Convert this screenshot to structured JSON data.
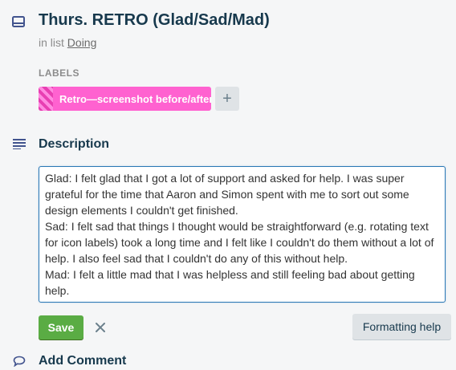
{
  "card": {
    "title": "Thurs. RETRO (Glad/Sad/Mad)",
    "in_list_prefix": "in list ",
    "list_name": "Doing"
  },
  "labels": {
    "heading": "LABELS",
    "items": [
      {
        "text": "Retro—screenshot before/after",
        "color": "#ff62d0"
      }
    ],
    "add_symbol": "+"
  },
  "description": {
    "heading": "Description",
    "value": "Glad: I felt glad that I got a lot of support and asked for help. I was super grateful for the time that Aaron and Simon spent with me to sort out some design elements I couldn't get finished.\nSad: I felt sad that things I thought would be straightforward (e.g. rotating text for icon labels) took a long time and I felt like I couldn't do them without a lot of help. I also feel sad that I couldn't do any of this without help.\nMad: I felt a little mad that I was helpless and still feeling bad about getting help."
  },
  "actions": {
    "save_label": "Save",
    "formatting_help_label": "Formatting help"
  },
  "comment": {
    "heading": "Add Comment"
  },
  "icons": {
    "card": "card-icon",
    "description": "description-lines-icon",
    "cancel": "close-icon",
    "comment": "comment-bubble-icon"
  },
  "colors": {
    "heading_text": "#17394d",
    "save": "#5aac44",
    "focus_border": "#2a78b5",
    "label_pink": "#ff62d0"
  }
}
